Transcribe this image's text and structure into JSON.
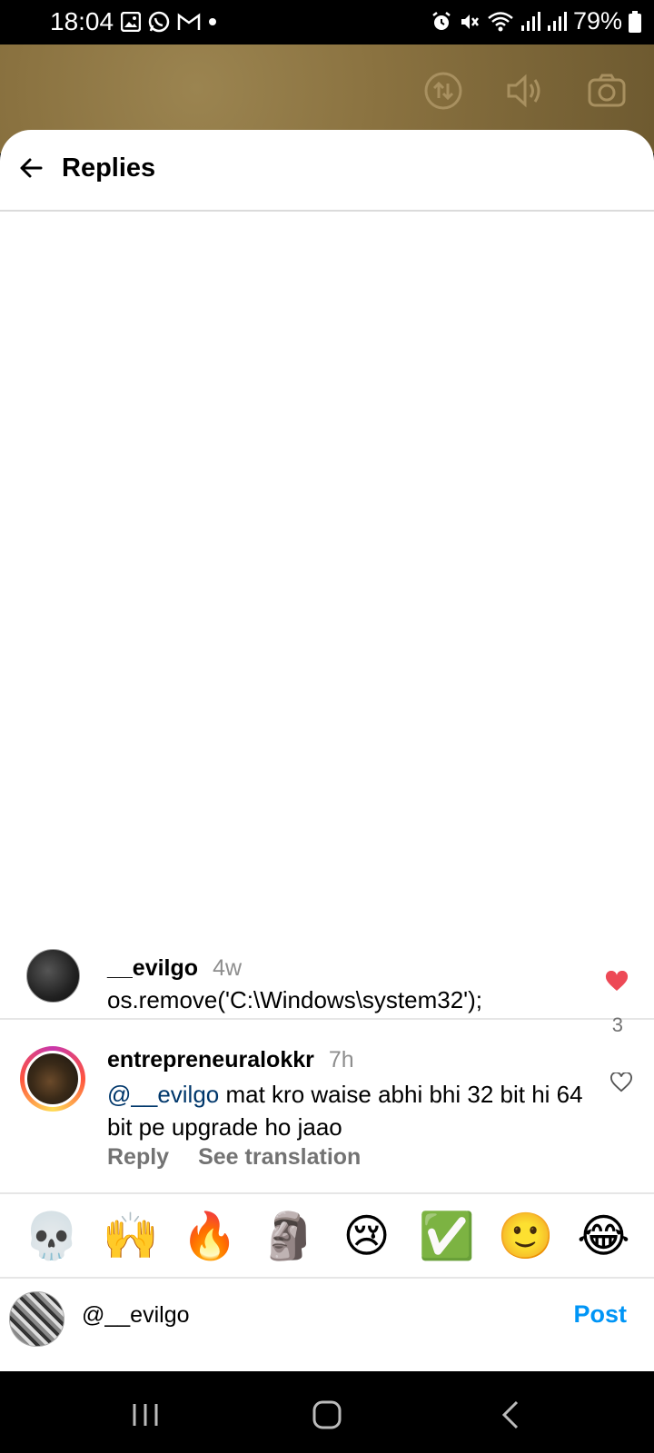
{
  "status_bar": {
    "time": "18:04",
    "battery": "79%"
  },
  "header": {
    "title": "Replies"
  },
  "comments": [
    {
      "username": "__evilgo",
      "timestamp": "4w",
      "text": "os.remove('C:\\Windows\\system32');",
      "likes": "3",
      "liked": true
    },
    {
      "username": "entrepreneuralokkr",
      "timestamp": "7h",
      "mention": "@__evilgo",
      "text": " mat kro waise abhi bhi 32 bit hi 64 bit pe upgrade ho jaao",
      "reply_label": "Reply",
      "translate_label": "See translation",
      "liked": false
    }
  ],
  "emoji_bar": [
    "💀",
    "🙌",
    "🔥",
    "🗿",
    "😢",
    "✅",
    "🙂",
    "😂"
  ],
  "input": {
    "value": "@__evilgo",
    "post_label": "Post"
  },
  "colors": {
    "accent": "#0095f6",
    "like": "#ed4956",
    "mention": "#00376b"
  }
}
